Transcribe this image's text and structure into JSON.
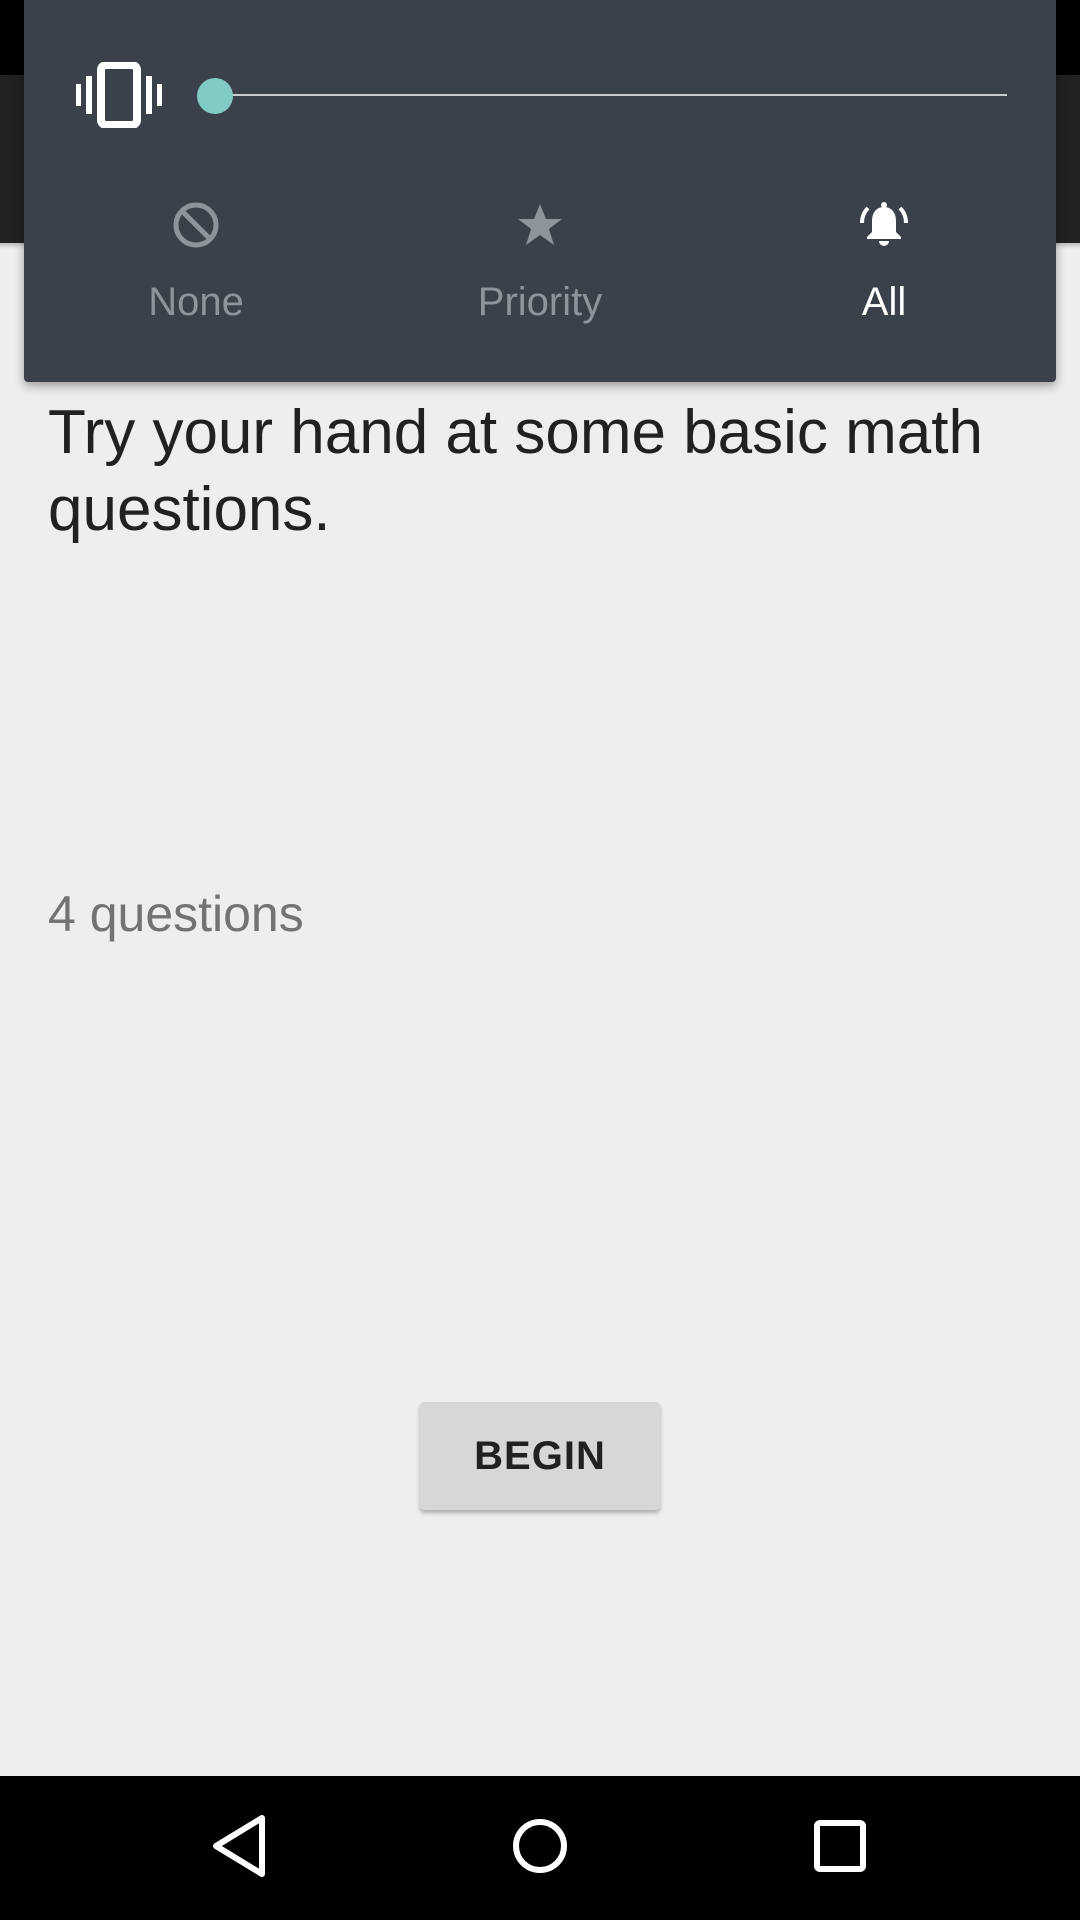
{
  "volume_panel": {
    "slider_level": 0,
    "accent_color": "#80cbc4",
    "modes": [
      {
        "label": "None",
        "icon": "block-icon",
        "active": false
      },
      {
        "label": "Priority",
        "icon": "star-icon",
        "active": false
      },
      {
        "label": "All",
        "icon": "bell-ringing-icon",
        "active": true
      }
    ]
  },
  "content": {
    "intro": "Try your hand at some basic math questions.",
    "question_count": "4 questions",
    "begin_label": "BEGIN"
  },
  "nav_bar": {
    "back": "back-icon",
    "home": "home-icon",
    "recents": "recents-icon"
  }
}
